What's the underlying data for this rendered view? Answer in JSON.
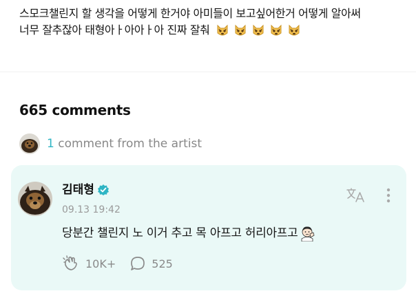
{
  "post": {
    "line1": "스모크챌린지 할 생각을 어떻게 한거야 아미들이 보고싶어한거 어떻게 알아써",
    "line2": "너무 잘추잖아 태형아ㅏ아아ㅏ아 진짜 잘춰",
    "emoji_icons": [
      "crying-cat-icon",
      "crying-cat-icon",
      "crying-cat-icon",
      "crying-cat-icon",
      "crying-cat-icon"
    ]
  },
  "comments": {
    "count_label": "665 comments",
    "artist_count": "1",
    "artist_label": "comment from the artist"
  },
  "artist_comment": {
    "author": "김태형",
    "timestamp": "09.13 19:42",
    "body": "당분간 챌린지 노 이거 추고 목 아프고 허리아프고",
    "body_emoji": "face-with-hand-icon",
    "likes": "10K+",
    "replies": "525",
    "card_color": "#eaf9f7",
    "accent_color": "#2fb5c4"
  },
  "icons": {
    "verified": "verified-check-icon",
    "translate": "translate-icon",
    "more": "more-vertical-icon",
    "like": "cheering-hand-icon",
    "reply": "speech-bubble-icon"
  }
}
